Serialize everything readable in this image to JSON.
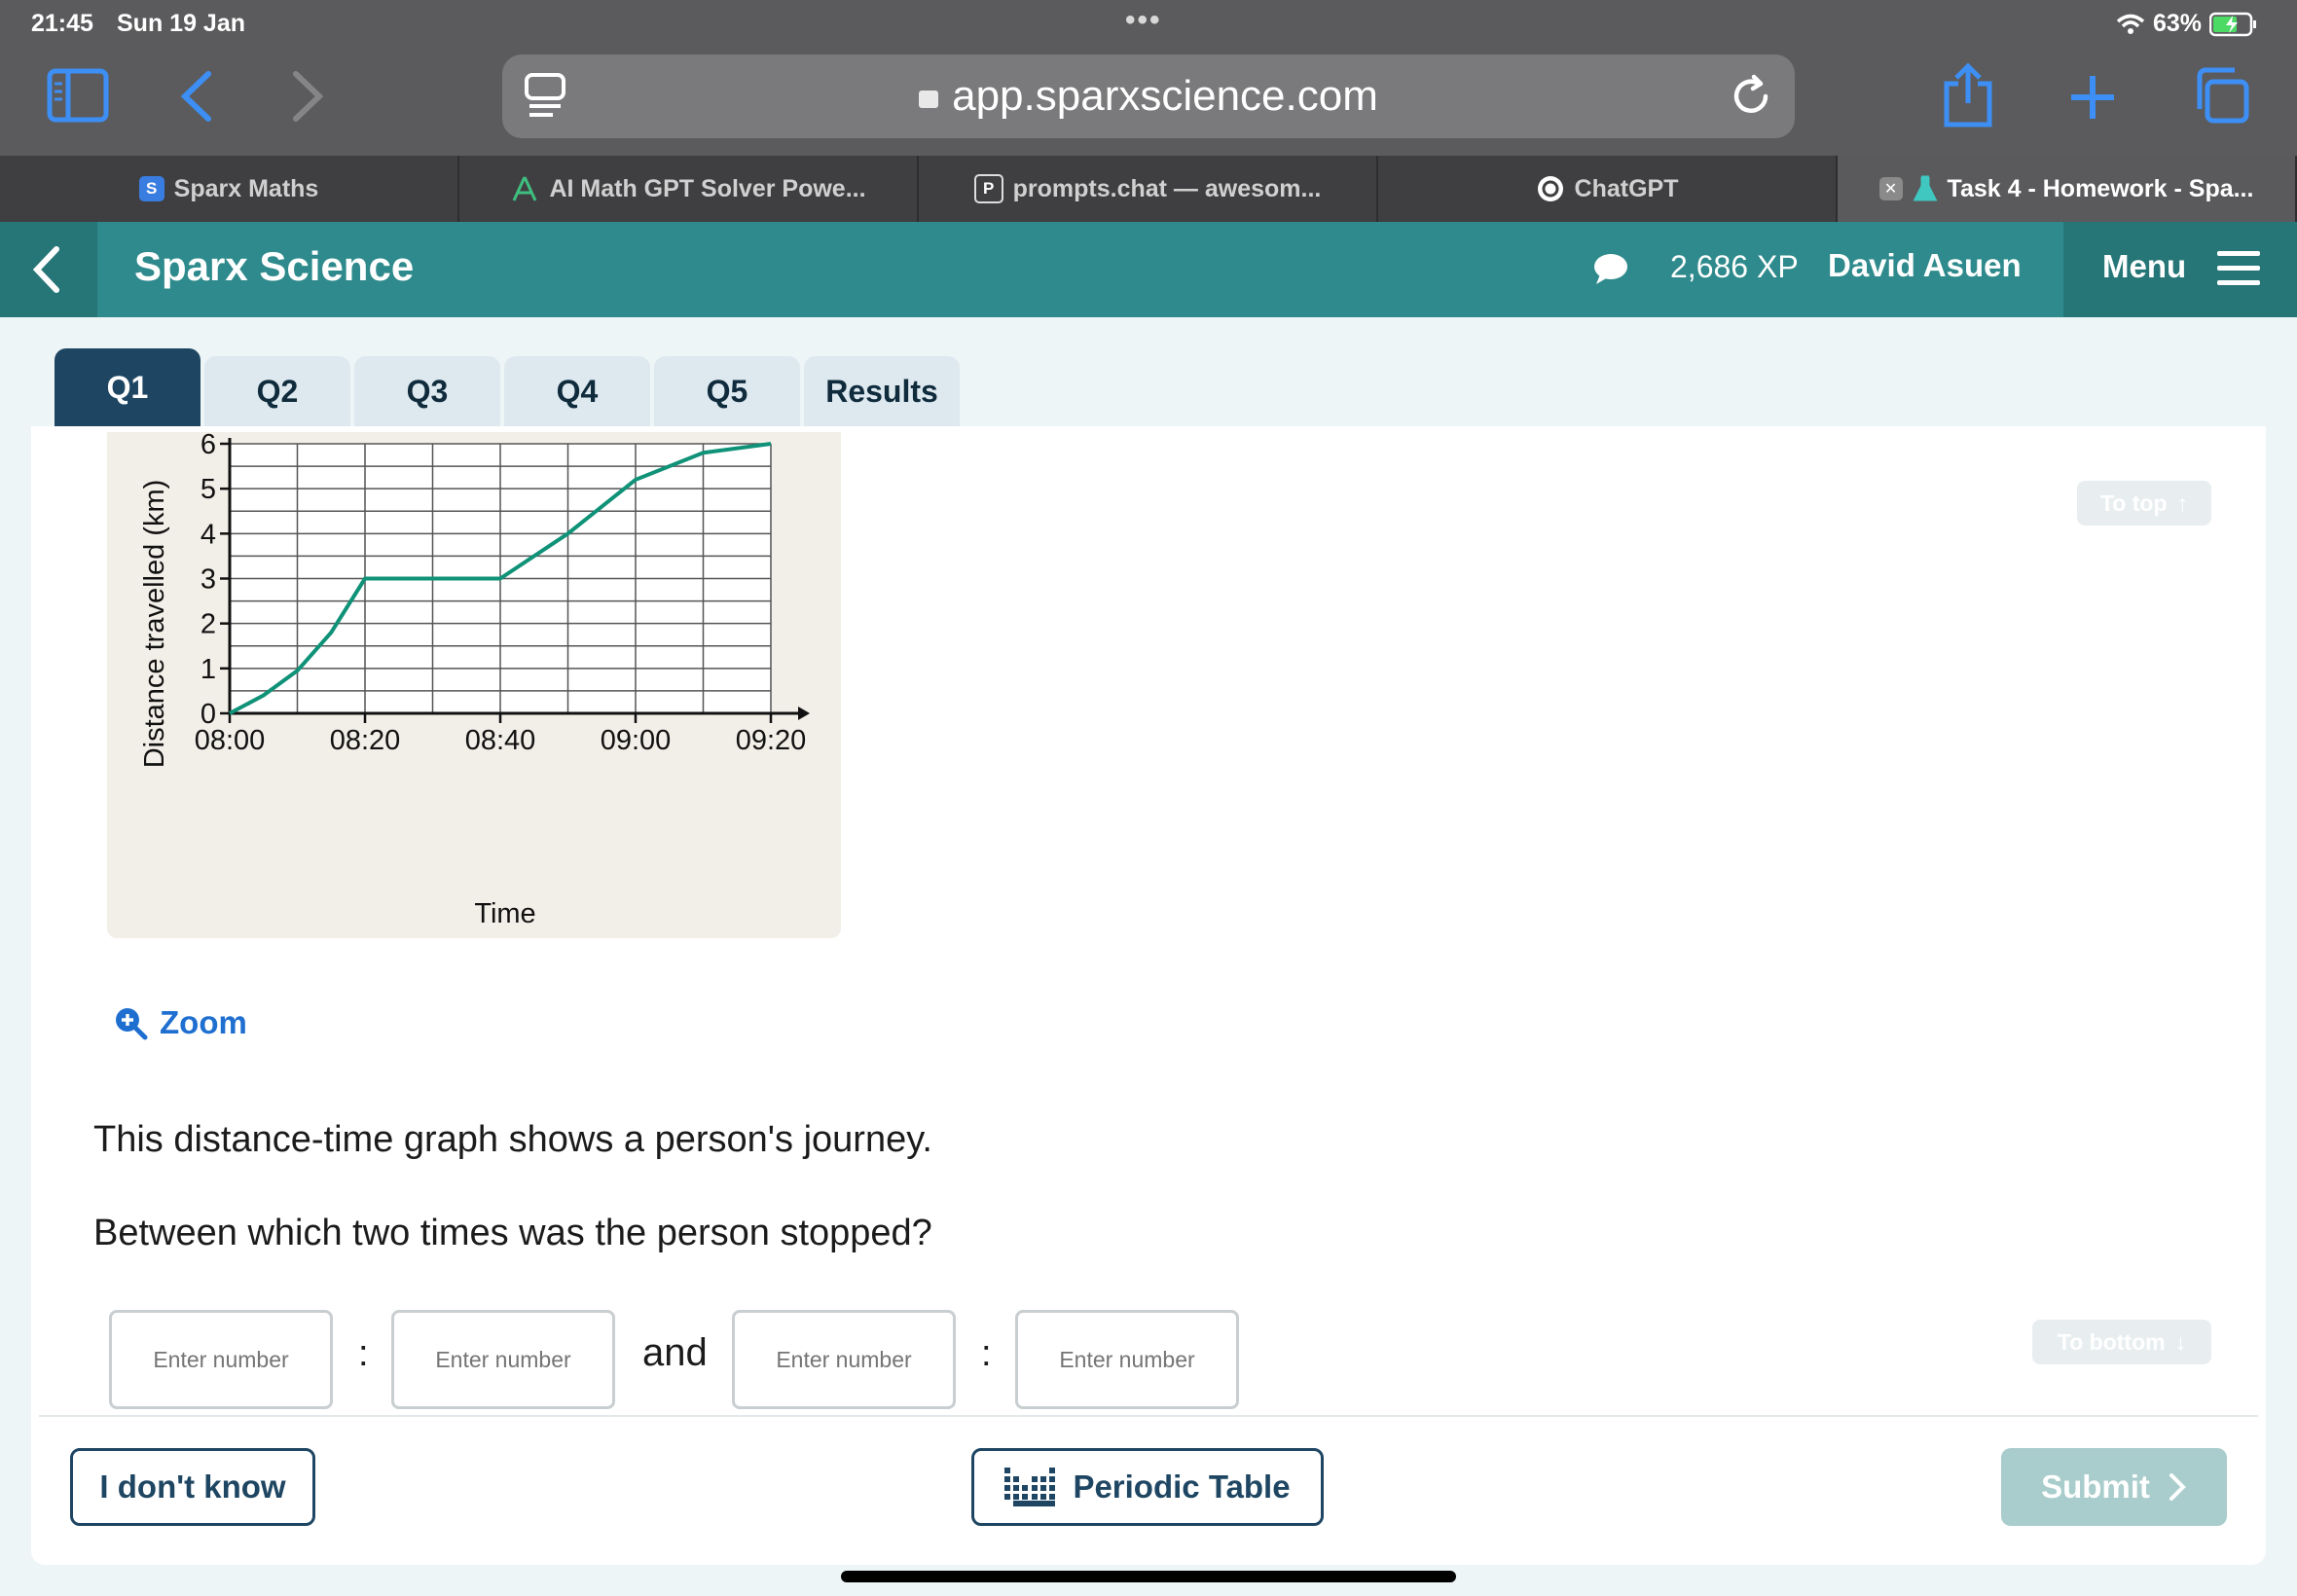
{
  "status_bar": {
    "time": "21:45",
    "date": "Sun 19 Jan",
    "battery": "63%"
  },
  "browser": {
    "url": "app.sparxscience.com",
    "tabs": [
      {
        "label": "Sparx Maths",
        "icon": "sparx-s-icon",
        "active": false
      },
      {
        "label": "AI Math GPT Solver Powe...",
        "icon": "ai-math-icon",
        "active": false
      },
      {
        "label": "prompts.chat — awesom...",
        "icon": "prompts-p-icon",
        "active": false
      },
      {
        "label": "ChatGPT",
        "icon": "chatgpt-icon",
        "active": false
      },
      {
        "label": "Task 4 - Homework - Spa...",
        "icon": "flask-icon",
        "active": true
      }
    ]
  },
  "app": {
    "title": "Sparx Science",
    "xp": "2,686 XP",
    "user": "David Asuen",
    "menu_label": "Menu"
  },
  "question_tabs": [
    "Q1",
    "Q2",
    "Q3",
    "Q4",
    "Q5",
    "Results"
  ],
  "chart_data": {
    "type": "line",
    "ylabel": "Distance travelled (km)",
    "xlabel": "Time",
    "x_ticks": [
      "08:00",
      "08:20",
      "08:40",
      "09:00",
      "09:20"
    ],
    "y_ticks": [
      "0",
      "1",
      "2",
      "3",
      "4",
      "5",
      "6"
    ],
    "ylim": [
      0,
      6
    ],
    "xlim_minutes_after_start": [
      0,
      80
    ],
    "grid": true,
    "series": [
      {
        "name": "",
        "x": [
          "08:00",
          "08:05",
          "08:10",
          "08:15",
          "08:20",
          "08:40",
          "08:50",
          "09:00",
          "09:10",
          "09:20"
        ],
        "values": [
          0,
          0.4,
          0.95,
          1.8,
          3.0,
          3.0,
          4.0,
          5.2,
          5.8,
          6.0
        ]
      }
    ]
  },
  "zoom_label": "Zoom",
  "question": {
    "line1": "This distance-time graph shows a person's journey.",
    "line2": "Between which two times was the person stopped?",
    "placeholder": "Enter number",
    "colon": ":",
    "and": "and"
  },
  "nav": {
    "to_top": "To top",
    "to_bottom": "To bottom"
  },
  "footer": {
    "dont_know": "I don't know",
    "periodic_table": "Periodic Table",
    "submit": "Submit"
  }
}
